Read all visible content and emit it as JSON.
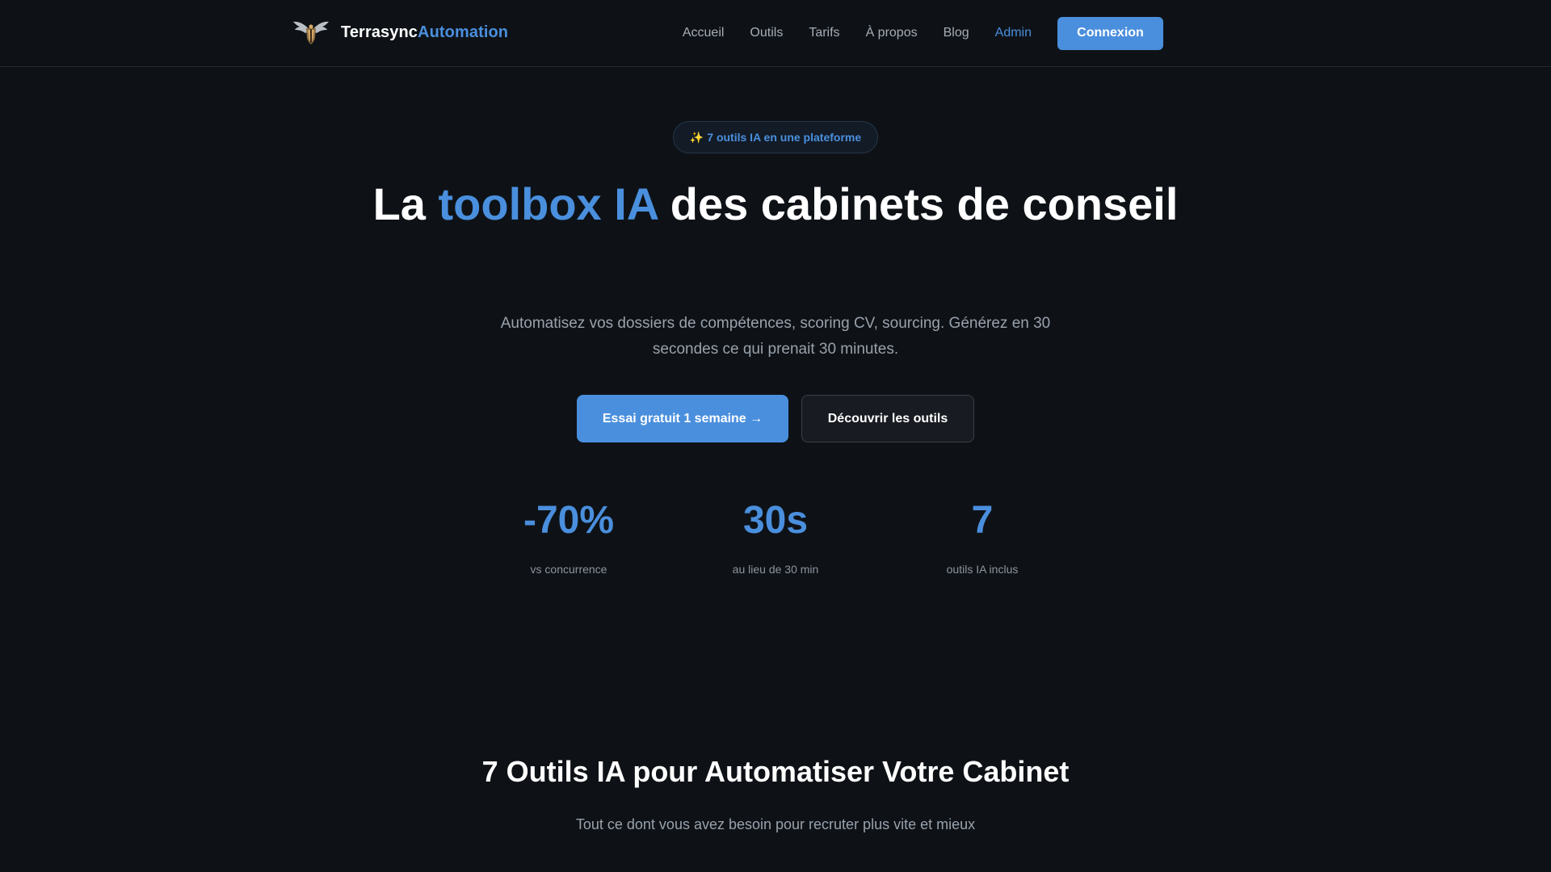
{
  "brand": {
    "name_part1": "Terrasync",
    "name_part2": "Automation",
    "logo_icon": "winged-crest-logo"
  },
  "nav": {
    "links": [
      "Accueil",
      "Outils",
      "Tarifs",
      "À propos",
      "Blog",
      "Admin"
    ],
    "login_label": "Connexion"
  },
  "hero": {
    "badge_icon": "✨",
    "badge_text": "7 outils IA en une plateforme",
    "title_prefix": "La ",
    "title_highlight": "toolbox IA",
    "title_suffix": " des cabinets de conseil",
    "subtitle": "Automatisez vos dossiers de compétences, scoring CV, sourcing. Générez en 30 secondes ce qui prenait 30 minutes.",
    "cta_primary": "Essai gratuit 1 semaine →",
    "cta_secondary": "Découvrir les outils"
  },
  "stats": [
    {
      "value": "-70%",
      "label": "vs concurrence"
    },
    {
      "value": "30s",
      "label": "au lieu de 30 min"
    },
    {
      "value": "7",
      "label": "outils IA inclus"
    }
  ],
  "tools_section": {
    "title": "7 Outils IA pour Automatiser Votre Cabinet",
    "subtitle": "Tout ce dont vous avez besoin pour recruter plus vite et mieux"
  },
  "colors": {
    "background": "#0e1217",
    "accent": "#4a8fdd",
    "muted_text": "#99a1ab"
  }
}
